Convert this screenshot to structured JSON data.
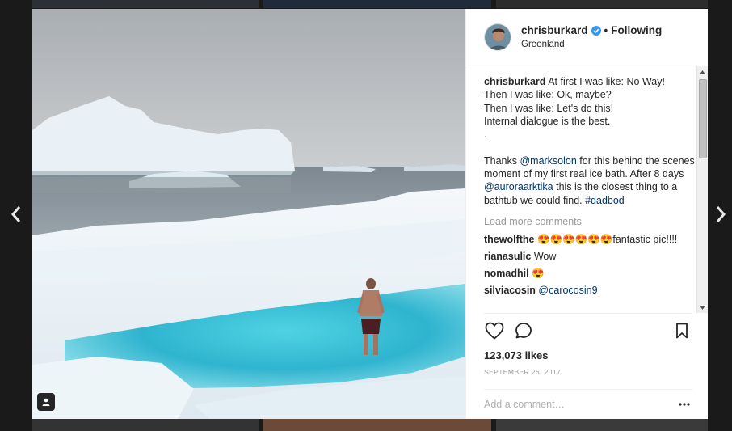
{
  "nav": {
    "prev_icon": "chevron-left-icon",
    "next_icon": "chevron-right-icon"
  },
  "post": {
    "username": "chrisburkard",
    "verified": true,
    "separator": "•",
    "follow_status": "Following",
    "location": "Greenland",
    "caption_user": "chrisburkard",
    "caption_lines": [
      "At first I was like: No Way!",
      "Then I was like: Ok, maybe?",
      "Then I was like: Let's do this!",
      "Internal dialogue is the best.",
      "."
    ],
    "caption_p2_a": "Thanks ",
    "mention_1": "@marksolon",
    "caption_p2_b": " for this behind the scenes moment of my first real ice bath. After 8 days ",
    "mention_2": "@auroraarktika",
    "caption_p2_c": " this is the closest thing to a bathtub we could find. ",
    "hashtag": "#dadbod",
    "load_more": "Load more comments",
    "comments": [
      {
        "user": "thewolfthe",
        "text": "😍😍😍😍😍😍fantastic pic!!!!"
      },
      {
        "user": "rianasulic",
        "text": "Wow"
      },
      {
        "user": "nomadhil",
        "text": "😍"
      },
      {
        "user": "silviacosin",
        "text": "@carocosin9"
      }
    ],
    "likes": "123,073 likes",
    "date": "September 26, 2017",
    "add_comment_placeholder": "Add a comment…"
  },
  "colors": {
    "link": "#003569",
    "verified_badge": "#3897f0",
    "muted": "#999999"
  }
}
